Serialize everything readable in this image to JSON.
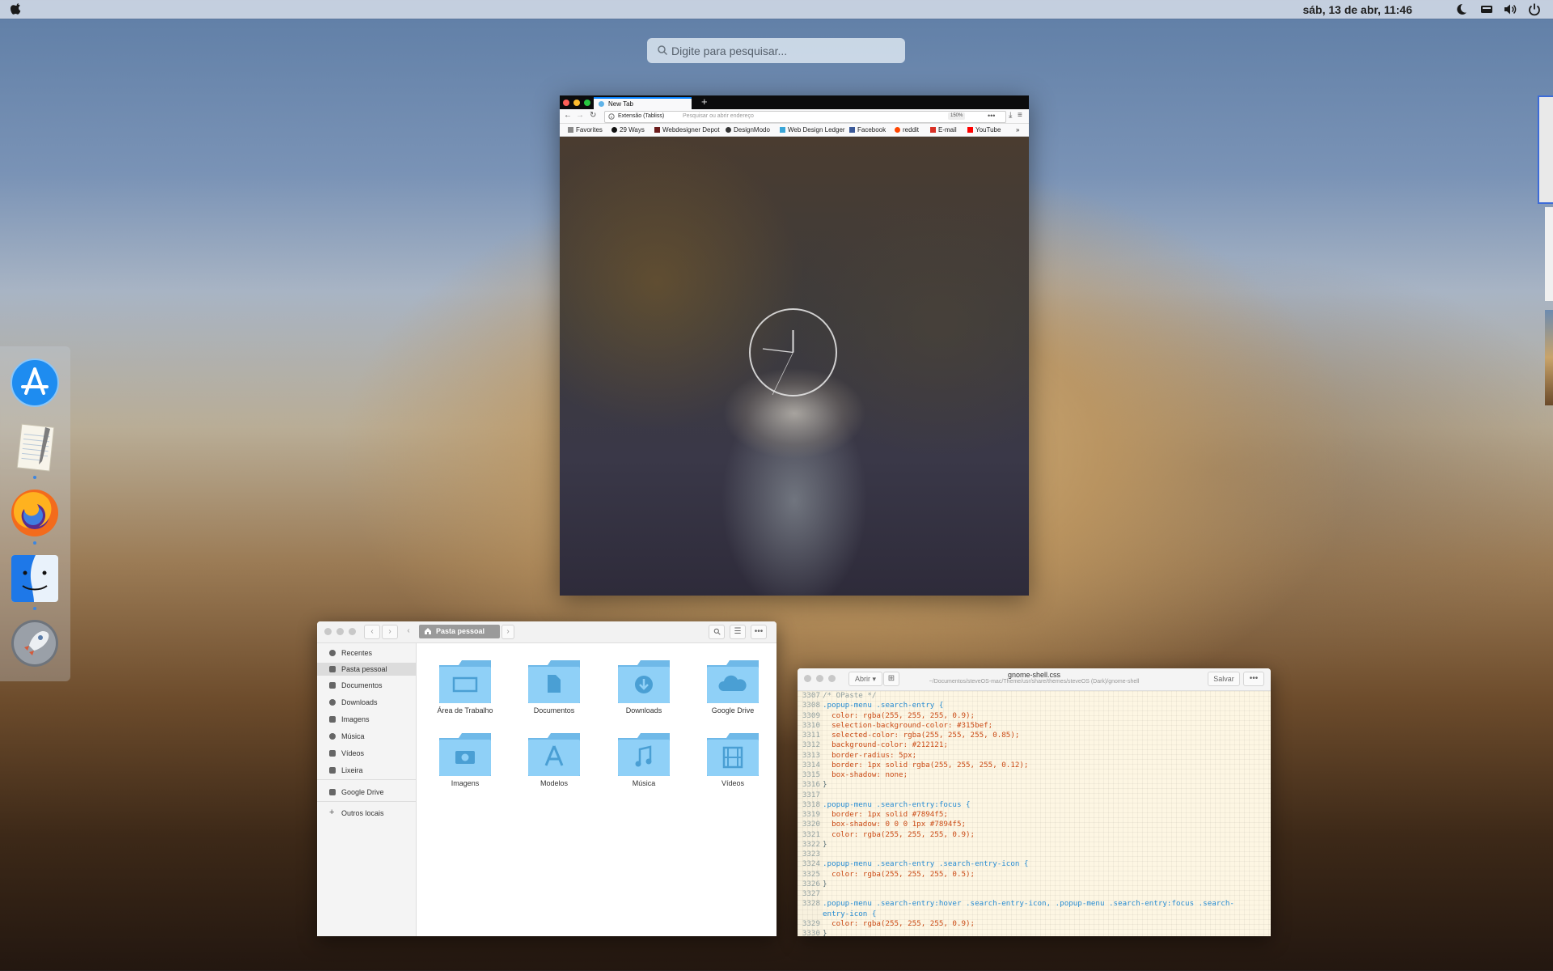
{
  "topbar": {
    "clock": "sáb, 13 de abr, 11:46",
    "tray_icons": [
      "moon-icon",
      "keyboard-icon",
      "volume-icon",
      "power-icon"
    ]
  },
  "search": {
    "placeholder": "Digite para pesquisar..."
  },
  "browser": {
    "tab_title": "New Tab",
    "identity": "Extensão (Tabliss)",
    "url_placeholder": "Pesquisar ou abrir endereço",
    "zoom": "150%",
    "bookmarks": [
      "Favorites",
      "29 Ways",
      "Webdesigner Depot",
      "DesignModo",
      "Web Design Ledger",
      "Facebook",
      "reddit",
      "E-mail",
      "YouTube"
    ]
  },
  "files": {
    "breadcrumb": "Pasta pessoal",
    "sidebar": [
      "Recentes",
      "Pasta pessoal",
      "Documentos",
      "Downloads",
      "Imagens",
      "Música",
      "Vídeos",
      "Lixeira",
      "Google Drive",
      "Outros locais"
    ],
    "active_sidebar": "Pasta pessoal",
    "folders": [
      "Área de Trabalho",
      "Documentos",
      "Downloads",
      "Google Drive",
      "Imagens",
      "Modelos",
      "Música",
      "Vídeos"
    ]
  },
  "editor": {
    "open_label": "Abrir",
    "save_label": "Salvar",
    "filename": "gnome-shell.css",
    "path": "~/Documentos/steveOS-mac/Theme/usr/share/themes/steveOS (Dark)/gnome-shell",
    "line_numbers": [
      "3307",
      "3308",
      "3309",
      "3310",
      "3311",
      "3312",
      "3313",
      "3314",
      "3315",
      "3316",
      "3317",
      "3318",
      "3319",
      "3320",
      "3321",
      "3322",
      "3323",
      "3324",
      "3325",
      "3326",
      "3327",
      "3328",
      "",
      "3329",
      "3330"
    ],
    "lines": [
      "/* OPaste */",
      ".popup-menu .search-entry {",
      "  color: rgba(255, 255, 255, 0.9);",
      "  selection-background-color: #315bef;",
      "  selected-color: rgba(255, 255, 255, 0.85);",
      "  background-color: #212121;",
      "  border-radius: 5px;",
      "  border: 1px solid rgba(255, 255, 255, 0.12);",
      "  box-shadow: none;",
      "}",
      "",
      ".popup-menu .search-entry:focus {",
      "  border: 1px solid #7894f5;",
      "  box-shadow: 0 0 0 1px #7894f5;",
      "  color: rgba(255, 255, 255, 0.9);",
      "}",
      "",
      ".popup-menu .search-entry .search-entry-icon {",
      "  color: rgba(255, 255, 255, 0.5);",
      "}",
      "",
      ".popup-menu .search-entry:hover .search-entry-icon, .popup-menu .search-entry:focus .search-",
      "entry-icon {",
      "  color: rgba(255, 255, 255, 0.9);",
      "}"
    ]
  },
  "dock": {
    "apps": [
      "app-store-icon",
      "text-editor-icon",
      "firefox-icon",
      "finder-icon",
      "launchpad-icon"
    ]
  },
  "colors": {
    "accent": "#3c86e0",
    "folder": "#7cc8f5",
    "editor_bg": "#fdf6e3"
  }
}
